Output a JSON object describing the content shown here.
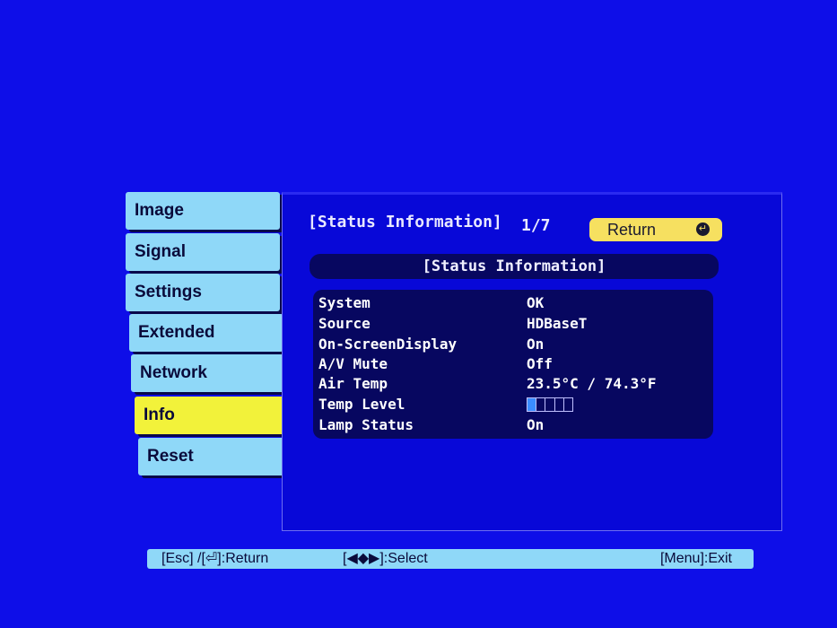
{
  "menu": {
    "items": [
      {
        "label": "Image",
        "active": false
      },
      {
        "label": "Signal",
        "active": false
      },
      {
        "label": "Settings",
        "active": false
      },
      {
        "label": "Extended",
        "active": false
      },
      {
        "label": "Network",
        "active": false
      },
      {
        "label": "Info",
        "active": true
      },
      {
        "label": "Reset",
        "active": false
      }
    ]
  },
  "panel": {
    "title": "[Status Information]",
    "page": "1/7",
    "return_label": "Return",
    "return_icon": "return-icon",
    "section_title": "[Status Information]"
  },
  "status": {
    "rows": [
      {
        "label": "System",
        "value": "OK"
      },
      {
        "label": "Source",
        "value": "HDBaseT"
      },
      {
        "label": "On-ScreenDisplay",
        "value": "On"
      },
      {
        "label": "A/V Mute",
        "value": "Off"
      },
      {
        "label": "Air Temp",
        "value": "23.5°C / 74.3°F"
      },
      {
        "label": "Temp Level",
        "value": ""
      },
      {
        "label": "Lamp Status",
        "value": "On"
      }
    ],
    "temp_level": {
      "filled": 1,
      "total": 5
    }
  },
  "footer": {
    "left": "[Esc] /[⏎]:Return",
    "middle": "[◀◆▶]:Select",
    "right": "[Menu]:Exit"
  },
  "colors": {
    "background": "#0e0ee8",
    "tab": "#8fd8f8",
    "tab_active": "#f2f23a",
    "return_button": "#f6e060",
    "status_box": "#070760"
  }
}
